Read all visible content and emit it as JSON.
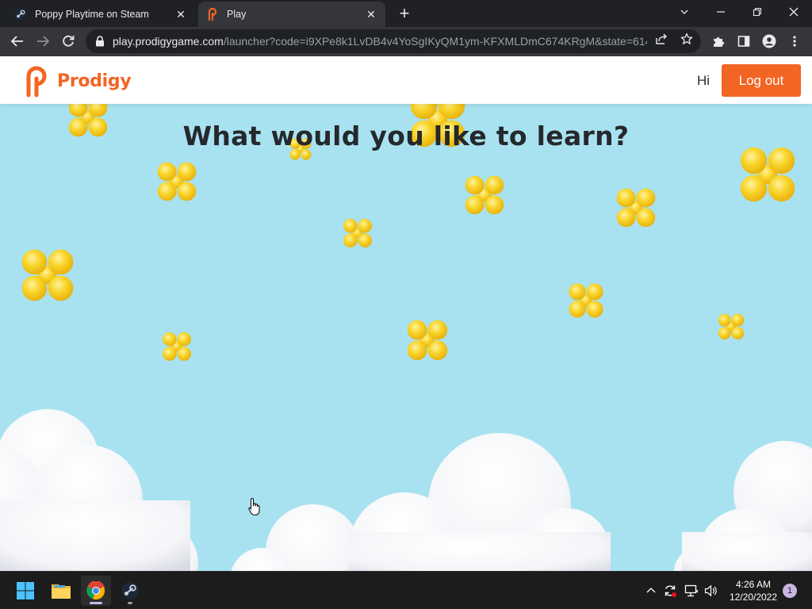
{
  "browser": {
    "tabs": [
      {
        "title": "Poppy Playtime on Steam",
        "favicon": "steam-icon",
        "active": false
      },
      {
        "title": "Play",
        "favicon": "prodigy-icon",
        "active": true
      }
    ],
    "new_tab": "+",
    "address": {
      "host": "play.prodigygame.com",
      "path": "/launcher?code=i9XPe8k1LvDB4v4YoSgIKyQM1ym-KFXMLDmC674KRgM&state=614..."
    }
  },
  "page": {
    "logo_text": "Prodigy",
    "greeting": "Hi",
    "logout_label": "Log out",
    "heading": "What would you like to learn?",
    "colors": {
      "brand": "#f26522",
      "sky": "#a8e2f0",
      "sparkle": "#f8cd1f",
      "heading": "#25282c"
    }
  },
  "taskbar": {
    "apps": [
      "windows-start-icon",
      "file-explorer-icon",
      "chrome-icon",
      "steam-icon"
    ],
    "clock_time": "4:26 AM",
    "clock_date": "12/20/2022",
    "notification_count": "1"
  }
}
